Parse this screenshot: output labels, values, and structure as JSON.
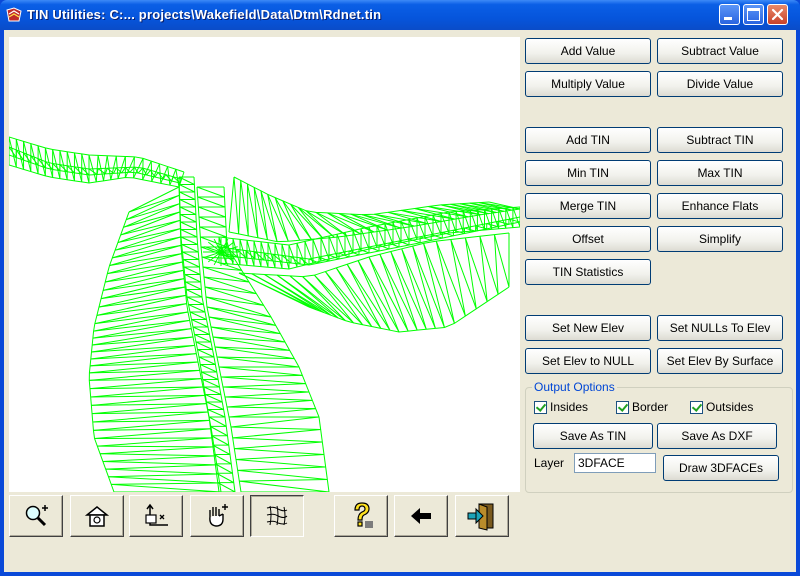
{
  "window": {
    "title": "TIN Utilities: C:... projects\\Wakefield\\Data\\Dtm\\Rdnet.tin"
  },
  "value_ops": {
    "add_value": "Add Value",
    "subtract_value": "Subtract Value",
    "multiply_value": "Multiply Value",
    "divide_value": "Divide Value"
  },
  "tin_ops": {
    "add_tin": "Add TIN",
    "subtract_tin": "Subtract TIN",
    "min_tin": "Min TIN",
    "max_tin": "Max TIN",
    "merge_tin": "Merge TIN",
    "enhance_flats": "Enhance Flats",
    "offset": "Offset",
    "simplify": "Simplify",
    "tin_statistics": "TIN Statistics"
  },
  "elev_ops": {
    "set_new_elev": "Set New Elev",
    "set_nulls_to_elev": "Set NULLs To Elev",
    "set_elev_to_null": "Set Elev to NULL",
    "set_elev_by_surface": "Set Elev By Surface"
  },
  "output_options": {
    "title": "Output Options",
    "insides": {
      "label": "Insides",
      "checked": true
    },
    "border": {
      "label": "Border",
      "checked": true
    },
    "outsides": {
      "label": "Outsides",
      "checked": true
    },
    "save_as_tin": "Save As TIN",
    "save_as_dxf": "Save As DXF",
    "layer_label": "Layer",
    "layer_value": "3DFACE",
    "draw_3dfaces": "Draw 3DFACEs"
  },
  "toolbar": {
    "icons": [
      "zoom-in-icon",
      "zoom-extents-icon",
      "pan-to-point-icon",
      "hand-pan-icon",
      "tin-display-icon",
      "help-icon",
      "back-arrow-icon",
      "exit-icon"
    ],
    "pressed": "tin-display-icon"
  },
  "colors": {
    "tin_lines": "#00ff00",
    "title_bar": "#0a5fe6",
    "group_title": "#0046d5"
  }
}
